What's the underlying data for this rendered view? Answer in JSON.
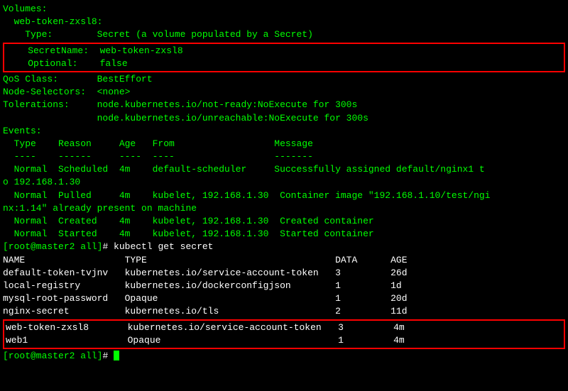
{
  "describe": {
    "volumes_header": "Volumes:",
    "volume_name": "  web-token-zxsl8:",
    "type_line": "    Type:        Secret (a volume populated by a Secret)",
    "secret_name_line": "    SecretName:  web-token-zxsl8",
    "optional_line": "    Optional:    false",
    "qos_line": "QoS Class:       BestEffort",
    "node_selectors": "Node-Selectors:  <none>",
    "tolerations1": "Tolerations:     node.kubernetes.io/not-ready:NoExecute for 300s",
    "tolerations2": "                 node.kubernetes.io/unreachable:NoExecute for 300s",
    "events_header": "Events:",
    "events_cols": "  Type    Reason     Age   From                  Message",
    "events_dash": "  ----    ------     ----  ----                  -------",
    "event1a": "  Normal  Scheduled  4m    default-scheduler     Successfully assigned default/nginx1 t",
    "event1b": "o 192.168.1.30",
    "event2a": "  Normal  Pulled     4m    kubelet, 192.168.1.30  Container image \"192.168.1.10/test/ngi",
    "event2b": "nx:1.14\" already present on machine",
    "event3": "  Normal  Created    4m    kubelet, 192.168.1.30  Created container",
    "event4": "  Normal  Started    4m    kubelet, 192.168.1.30  Started container"
  },
  "prompt1": {
    "user_host": "[root@master2 all]",
    "hash": "# ",
    "cmd": "kubectl get secret"
  },
  "secrets": {
    "header": "NAME                  TYPE                                  DATA      AGE",
    "rows": [
      "default-token-tvjnv   kubernetes.io/service-account-token   3         26d",
      "local-registry        kubernetes.io/dockerconfigjson        1         1d",
      "mysql-root-password   Opaque                                1         20d",
      "nginx-secret          kubernetes.io/tls                     2         11d"
    ],
    "boxed": [
      "web-token-zxsl8       kubernetes.io/service-account-token   3         4m",
      "web1                  Opaque                                1         4m"
    ]
  },
  "prompt2": {
    "user_host": "[root@master2 all]",
    "hash": "# "
  }
}
